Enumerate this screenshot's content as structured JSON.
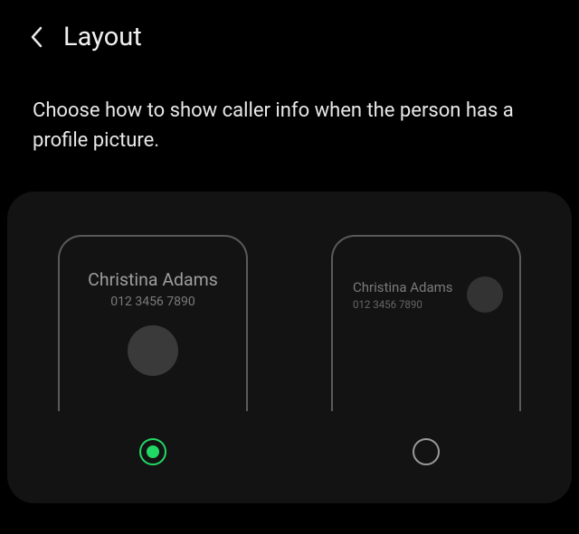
{
  "header": {
    "title": "Layout"
  },
  "description": "Choose how to show caller info when the person has a profile picture.",
  "options": {
    "centered": {
      "caller_name": "Christina Adams",
      "caller_number": "012 3456 7890",
      "selected": true
    },
    "compact": {
      "caller_name": "Christina Adams",
      "caller_number": "012 3456 7890",
      "selected": false
    }
  },
  "colors": {
    "accent": "#22d864"
  }
}
